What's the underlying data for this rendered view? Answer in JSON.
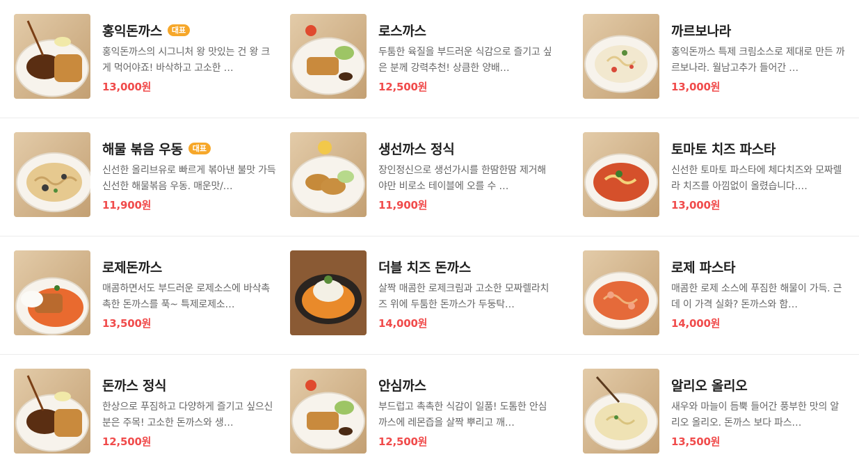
{
  "menu": {
    "columns": [
      {
        "items": [
          {
            "name": "홍익돈까스",
            "badge": "대표",
            "desc": "홍익돈까스의 시그니처 왕 맛있는 건 왕 크게 먹어야죠! 바삭하고 고소한 …",
            "price": "13,000원",
            "img": "cutlet-sauce"
          },
          {
            "name": "해물 볶음 우동",
            "badge": "대표",
            "desc": "신선한 올리브유로 빠르게 볶아낸 불맛 가득 신선한 해물볶음 우동. 매운맛/…",
            "price": "11,900원",
            "img": "udon"
          },
          {
            "name": "로제돈까스",
            "badge": "",
            "desc": "매콤하면서도 부드러운 로제소스에 바삭촉촉한 돈까스를 푹~ 특제로제소…",
            "price": "13,500원",
            "img": "rose-cutlet"
          },
          {
            "name": "돈까스 정식",
            "badge": "",
            "desc": "한상으로 푸짐하고 다양하게 즐기고 싶으신 분은 주목! 고소한 돈까스와 생…",
            "price": "12,500원",
            "img": "cutlet-set"
          }
        ]
      },
      {
        "items": [
          {
            "name": "로스까스",
            "badge": "",
            "desc": "두툼한 육질을 부드러운 식감으로 즐기고 싶은 분께 강력추천! 상큼한 양배…",
            "price": "12,500원",
            "img": "loin-cutlet"
          },
          {
            "name": "생선까스 정식",
            "badge": "",
            "desc": "장인정신으로 생선가시를 한땀한땀 제거해야만 비로소 테이블에 오를 수 …",
            "price": "11,900원",
            "img": "fish-cutlet"
          },
          {
            "name": "더블 치즈 돈까스",
            "badge": "",
            "desc": "살짝 매콤한 로제크림과 고소한 모짜렐라치즈 위에 두툼한 돈까스가 두둥탁…",
            "price": "14,000원",
            "img": "double-cheese"
          },
          {
            "name": "안심까스",
            "badge": "",
            "desc": "부드럽고 촉촉한 식감이 일품! 도톰한 안심까스에 레몬즙을 살짝 뿌리고 깨…",
            "price": "12,500원",
            "img": "tenderloin"
          }
        ]
      },
      {
        "items": [
          {
            "name": "까르보나라",
            "badge": "",
            "desc": "홍익돈까스 특제 크림소스로 제대로 만든 까르보나라. 월남고추가 들어간 …",
            "price": "13,000원",
            "img": "carbonara"
          },
          {
            "name": "토마토 치즈 파스타",
            "badge": "",
            "desc": "신선한 토마토 파스타에 체다치즈와 모짜렐라 치즈를 아낌없이 올렸습니다.…",
            "price": "13,000원",
            "img": "tomato-pasta"
          },
          {
            "name": "로제 파스타",
            "badge": "",
            "desc": "매콤한 로제 소스에 푸짐한 해물이 가득. 근데 이 가격 실화? 돈까스와 함…",
            "price": "14,000원",
            "img": "rose-pasta"
          },
          {
            "name": "알리오 올리오",
            "badge": "",
            "desc": "새우와 마늘이 듬뿍 들어간 풍부한 맛의 알리오 올리오. 돈까스 보다 파스…",
            "price": "13,500원",
            "img": "aglio"
          }
        ]
      }
    ]
  },
  "colors": {
    "price": "#f04b4b",
    "badge": "#f6a72a",
    "name": "#1f1f1f",
    "desc": "#666666"
  }
}
